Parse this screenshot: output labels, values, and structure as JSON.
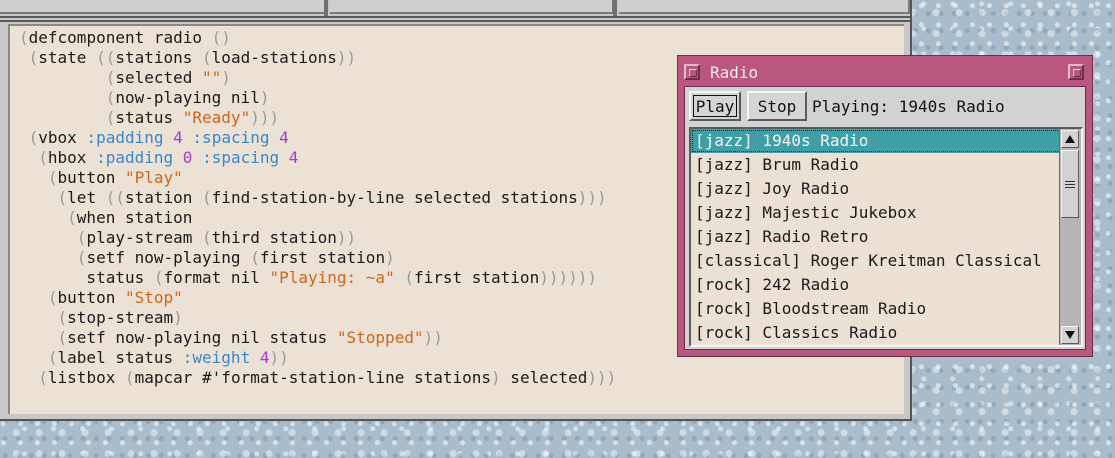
{
  "editor": {
    "lines": [
      [
        {
          "t": "(",
          "c": "p"
        },
        {
          "t": "defcomponent radio ",
          "c": ""
        },
        {
          "t": "()",
          "c": "p"
        }
      ],
      [
        {
          "t": " (",
          "c": "p"
        },
        {
          "t": "state ",
          "c": ""
        },
        {
          "t": "((",
          "c": "p"
        },
        {
          "t": "stations ",
          "c": ""
        },
        {
          "t": "(",
          "c": "p"
        },
        {
          "t": "load-stations",
          "c": ""
        },
        {
          "t": "))",
          "c": "p"
        }
      ],
      [
        {
          "t": "         (",
          "c": "p"
        },
        {
          "t": "selected ",
          "c": ""
        },
        {
          "t": "\"\"",
          "c": "s"
        },
        {
          "t": ")",
          "c": "p"
        }
      ],
      [
        {
          "t": "         (",
          "c": "p"
        },
        {
          "t": "now-playing nil",
          "c": ""
        },
        {
          "t": ")",
          "c": "p"
        }
      ],
      [
        {
          "t": "         (",
          "c": "p"
        },
        {
          "t": "status ",
          "c": ""
        },
        {
          "t": "\"Ready\"",
          "c": "s"
        },
        {
          "t": ")))",
          "c": "p"
        }
      ],
      [
        {
          "t": " (",
          "c": "p"
        },
        {
          "t": "vbox ",
          "c": ""
        },
        {
          "t": ":padding ",
          "c": "k"
        },
        {
          "t": "4",
          "c": "n"
        },
        {
          "t": " ",
          "c": ""
        },
        {
          "t": ":spacing ",
          "c": "k"
        },
        {
          "t": "4",
          "c": "n"
        }
      ],
      [
        {
          "t": "  (",
          "c": "p"
        },
        {
          "t": "hbox ",
          "c": ""
        },
        {
          "t": ":padding ",
          "c": "k"
        },
        {
          "t": "0",
          "c": "n"
        },
        {
          "t": " ",
          "c": ""
        },
        {
          "t": ":spacing ",
          "c": "k"
        },
        {
          "t": "4",
          "c": "n"
        }
      ],
      [
        {
          "t": "   (",
          "c": "p"
        },
        {
          "t": "button ",
          "c": ""
        },
        {
          "t": "\"Play\"",
          "c": "s"
        }
      ],
      [
        {
          "t": "    (",
          "c": "p"
        },
        {
          "t": "let ",
          "c": ""
        },
        {
          "t": "((",
          "c": "p"
        },
        {
          "t": "station ",
          "c": ""
        },
        {
          "t": "(",
          "c": "p"
        },
        {
          "t": "find-station-by-line selected stations",
          "c": ""
        },
        {
          "t": ")))",
          "c": "p"
        }
      ],
      [
        {
          "t": "     (",
          "c": "p"
        },
        {
          "t": "when station",
          "c": ""
        }
      ],
      [
        {
          "t": "      (",
          "c": "p"
        },
        {
          "t": "play-stream ",
          "c": ""
        },
        {
          "t": "(",
          "c": "p"
        },
        {
          "t": "third station",
          "c": ""
        },
        {
          "t": "))",
          "c": "p"
        }
      ],
      [
        {
          "t": "      (",
          "c": "p"
        },
        {
          "t": "setf now-playing ",
          "c": ""
        },
        {
          "t": "(",
          "c": "p"
        },
        {
          "t": "first station",
          "c": ""
        },
        {
          "t": ")",
          "c": "p"
        }
      ],
      [
        {
          "t": "       status ",
          "c": ""
        },
        {
          "t": "(",
          "c": "p"
        },
        {
          "t": "format nil ",
          "c": ""
        },
        {
          "t": "\"Playing: ~a\"",
          "c": "s"
        },
        {
          "t": " (",
          "c": "p"
        },
        {
          "t": "first station",
          "c": ""
        },
        {
          "t": "))))))",
          "c": "p"
        }
      ],
      [
        {
          "t": "   (",
          "c": "p"
        },
        {
          "t": "button ",
          "c": ""
        },
        {
          "t": "\"Stop\"",
          "c": "s"
        }
      ],
      [
        {
          "t": "    (",
          "c": "p"
        },
        {
          "t": "stop-stream",
          "c": ""
        },
        {
          "t": ")",
          "c": "p"
        }
      ],
      [
        {
          "t": "    (",
          "c": "p"
        },
        {
          "t": "setf now-playing nil status ",
          "c": ""
        },
        {
          "t": "\"Stopped\"",
          "c": "s"
        },
        {
          "t": "))",
          "c": "p"
        }
      ],
      [
        {
          "t": "   (",
          "c": "p"
        },
        {
          "t": "label status ",
          "c": ""
        },
        {
          "t": ":weight ",
          "c": "k"
        },
        {
          "t": "4",
          "c": "n"
        },
        {
          "t": "))",
          "c": "p"
        }
      ],
      [
        {
          "t": "  (",
          "c": "p"
        },
        {
          "t": "listbox ",
          "c": ""
        },
        {
          "t": "(",
          "c": "p"
        },
        {
          "t": "mapcar #'format-station-line stations",
          "c": ""
        },
        {
          "t": ")",
          "c": "p"
        },
        {
          "t": " selected",
          "c": ""
        },
        {
          "t": ")))",
          "c": "p"
        }
      ]
    ]
  },
  "radio": {
    "title": "Radio",
    "play_label": "Play",
    "stop_label": "Stop",
    "status": "Playing: 1940s Radio",
    "stations": [
      "[jazz] 1940s Radio",
      "[jazz] Brum Radio",
      "[jazz] Joy Radio",
      "[jazz] Majestic Jukebox",
      "[jazz] Radio Retro",
      "[classical] Roger Kreitman Classical",
      "[rock] 242 Radio",
      "[rock] Bloodstream Radio",
      "[rock] Classics Radio"
    ],
    "selected_index": 0
  },
  "colors": {
    "title_bar": "#b9577e",
    "selection": "#3f9ea6",
    "string": "#d0651e",
    "keyword": "#3b86c8",
    "number": "#a03ed4",
    "paren": "#9a9a9a"
  }
}
